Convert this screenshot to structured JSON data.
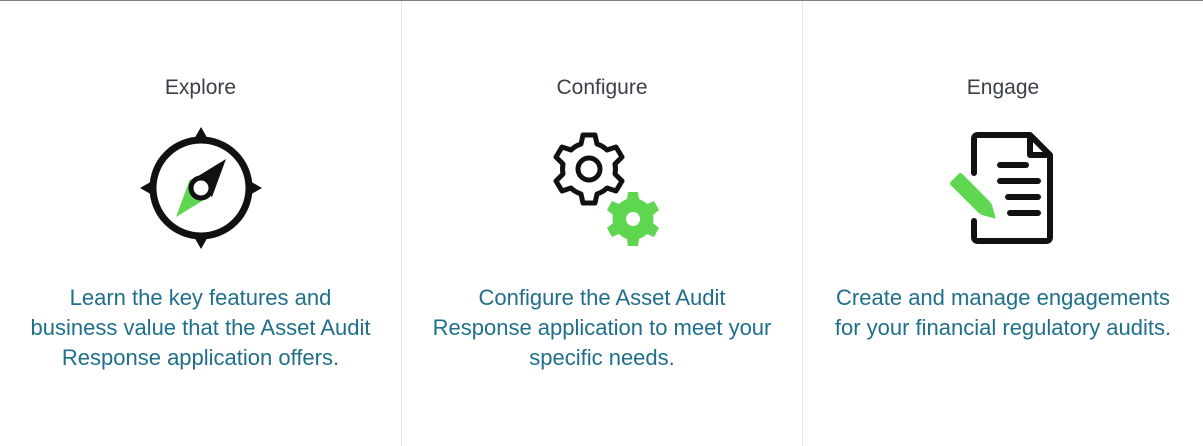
{
  "cards": [
    {
      "title": "Explore",
      "icon": "compass-icon",
      "description": "Learn the key features and business value that the Asset Audit Response application offers."
    },
    {
      "title": "Configure",
      "icon": "gears-icon",
      "description": "Configure the Asset Audit Response application to meet your specific needs."
    },
    {
      "title": "Engage",
      "icon": "document-edit-icon",
      "description": "Create and manage engagements for your financial regulatory audits."
    }
  ],
  "colors": {
    "title_text": "#3a4047",
    "description_text": "#1f6f8b",
    "icon_stroke": "#111111",
    "icon_accent": "#5ed64f",
    "divider": "#e3e5e8",
    "top_rule": "#7b7f85"
  }
}
